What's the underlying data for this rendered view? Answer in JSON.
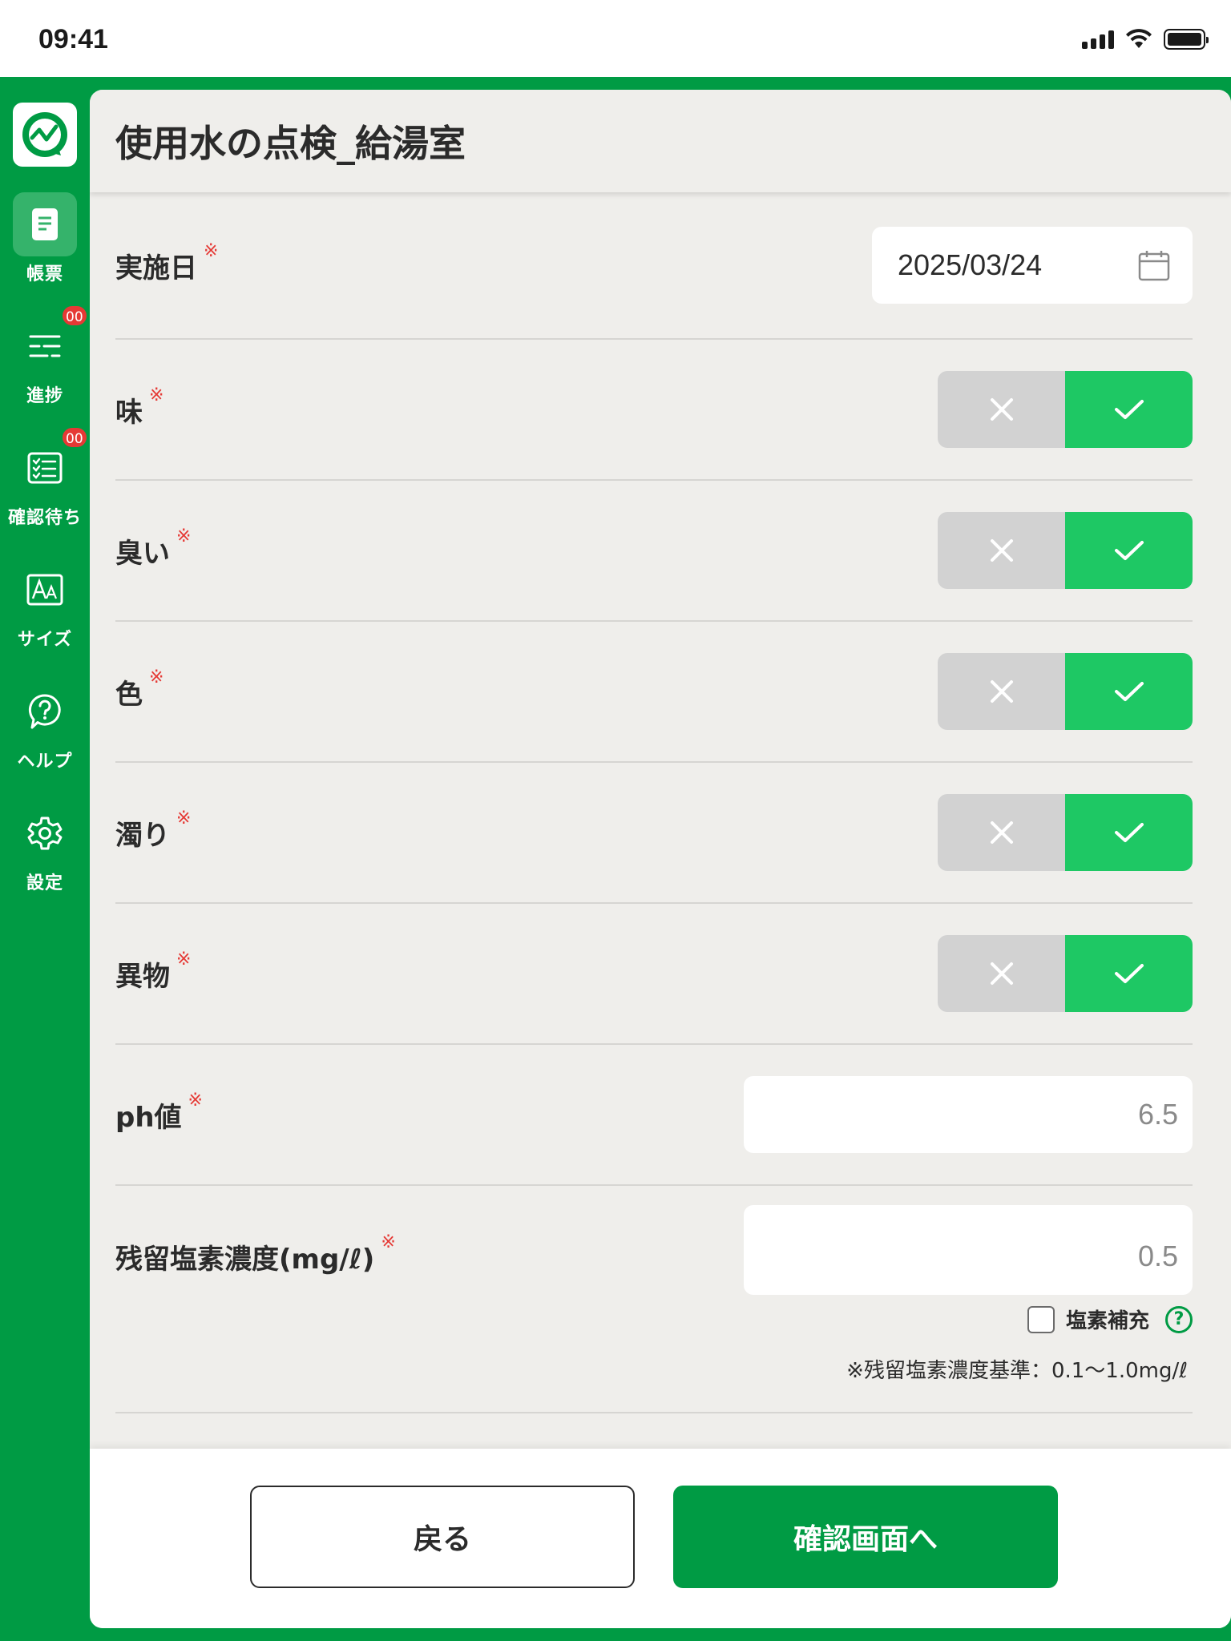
{
  "status_bar": {
    "time": "09:41"
  },
  "sidebar": {
    "items": [
      {
        "label": "帳票",
        "icon": "document-icon",
        "active": true,
        "badge": ""
      },
      {
        "label": "進捗",
        "icon": "progress-list-icon",
        "active": false,
        "badge": "00"
      },
      {
        "label": "確認待ち",
        "icon": "checklist-icon",
        "active": false,
        "badge": "00"
      },
      {
        "label": "サイズ",
        "icon": "text-size-icon",
        "active": false,
        "badge": ""
      },
      {
        "label": "ヘルプ",
        "icon": "help-icon",
        "active": false,
        "badge": ""
      },
      {
        "label": "設定",
        "icon": "gear-icon",
        "active": false,
        "badge": ""
      }
    ]
  },
  "page": {
    "title": "使用水の点検_給湯室"
  },
  "form": {
    "required_mark": "※",
    "date": {
      "label": "実施日",
      "value": "2025/03/24"
    },
    "checks": [
      {
        "label": "味",
        "value": "ok"
      },
      {
        "label": "臭い",
        "value": "ok"
      },
      {
        "label": "色",
        "value": "ok"
      },
      {
        "label": "濁り",
        "value": "ok"
      },
      {
        "label": "異物",
        "value": "ok"
      }
    ],
    "ph": {
      "label": "ph値",
      "placeholder": "6.5"
    },
    "chlorine": {
      "label": "残留塩素濃度(mg/ℓ)",
      "placeholder": "0.5",
      "checkbox_label": "塩素補充",
      "checkbox_checked": false,
      "note": "※残留塩素濃度基準：0.1〜1.0mg/ℓ"
    }
  },
  "footer": {
    "back_label": "戻る",
    "confirm_label": "確認画面へ"
  },
  "colors": {
    "brand_green": "#009b44",
    "toggle_on": "#1ec864",
    "toggle_off": "#d2d2d2",
    "badge_red": "#e53935"
  }
}
